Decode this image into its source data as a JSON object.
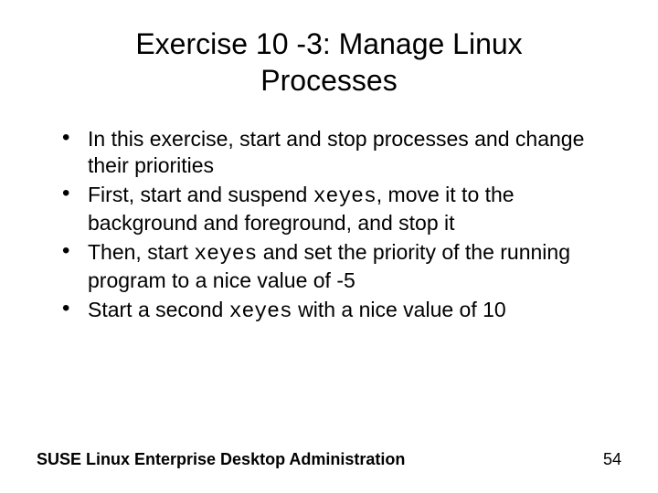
{
  "title": "Exercise 10 -3: Manage Linux Processes",
  "bullets": [
    {
      "segments": [
        {
          "text": "In this exercise, start and stop processes and change their priorities",
          "mono": false
        }
      ]
    },
    {
      "segments": [
        {
          "text": "First, start and suspend ",
          "mono": false
        },
        {
          "text": "xeyes",
          "mono": true
        },
        {
          "text": ", move it to the background and foreground, and stop it",
          "mono": false
        }
      ]
    },
    {
      "segments": [
        {
          "text": "Then, start ",
          "mono": false
        },
        {
          "text": "xeyes",
          "mono": true
        },
        {
          "text": " and set the priority of the running program to a nice value of -5",
          "mono": false
        }
      ]
    },
    {
      "segments": [
        {
          "text": "Start a second ",
          "mono": false
        },
        {
          "text": "xeyes",
          "mono": true
        },
        {
          "text": " with a nice value of 10",
          "mono": false
        }
      ]
    }
  ],
  "footer": {
    "left": "SUSE Linux Enterprise Desktop Administration",
    "right": "54"
  }
}
